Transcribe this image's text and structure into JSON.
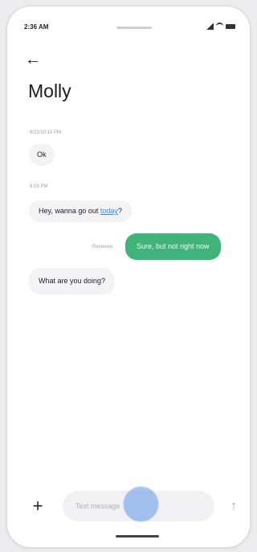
{
  "status_bar": {
    "time": "2:36 AM",
    "icons": [
      "signal-icon",
      "wifi-icon",
      "battery-icon"
    ]
  },
  "header": {
    "back_icon": "arrow-left-icon",
    "title": "Molly"
  },
  "messages": [
    {
      "timestamp": "6/21/10:10 PM",
      "text": "Ok"
    },
    {
      "timestamp": "6:03 PM",
      "text_prefix": "Hey, wanna go out ",
      "text_link": "today",
      "text_suffix": "?"
    },
    {
      "status": "Received",
      "text": "Sure, but not right now"
    },
    {
      "text": "What are you doing?"
    }
  ],
  "composer": {
    "placeholder": "Text message",
    "plus_icon": "plus-icon",
    "send_icon": "send-arrow-icon"
  },
  "colors": {
    "outgoing_bubble": "#40b37a",
    "incoming_bubble": "#f3f3f5",
    "link": "#4a87e8"
  }
}
